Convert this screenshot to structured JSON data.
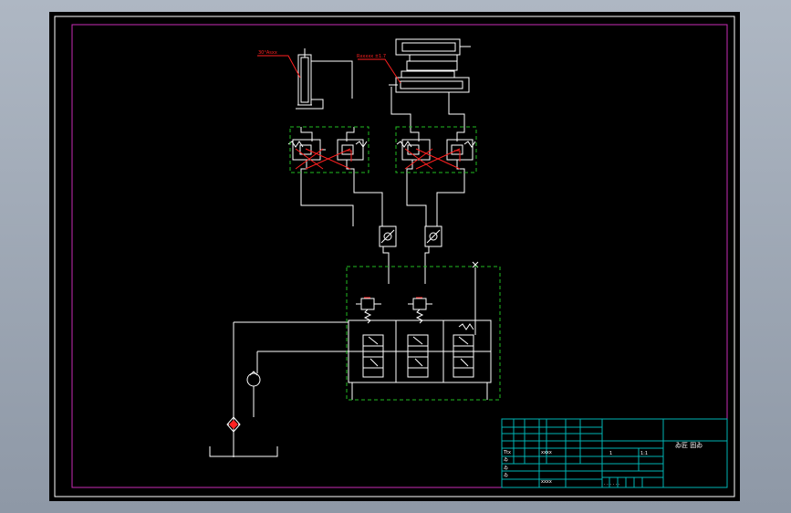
{
  "colors": {
    "background": "#000000",
    "frame": "#ffffff",
    "sheet_border": "#c82bb6",
    "callout": "#ff2020",
    "subsystem_box": "#22bb22",
    "title_block": "#00b4b4",
    "lines": "#ffffff"
  },
  "annotations": {
    "left_cylinder_label": "30°Asxx",
    "right_cylinder_label": "Rxxxxx ±1.7"
  },
  "title_block": {
    "drawing_title": "ゐ匠 固ゐ",
    "row_labels": [
      "Ttx",
      "ゐ",
      "ゐ",
      "ゐ"
    ],
    "cell_a": "xxxx",
    "cell_b": "xxxx",
    "scale": "1:1",
    "sheet": "1",
    "bottom_hint": "· · · · · ·"
  }
}
